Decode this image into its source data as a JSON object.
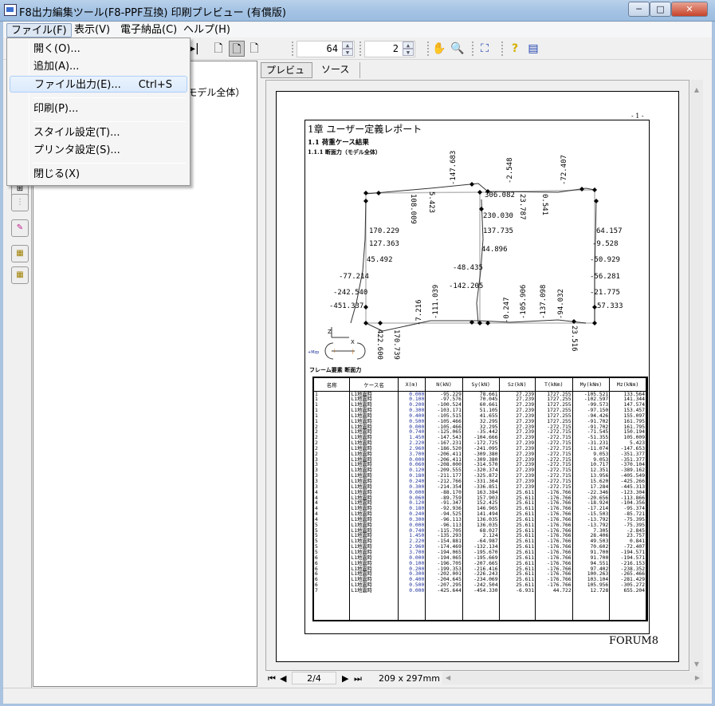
{
  "window": {
    "title": "F8出力編集ツール(F8-PPF互換) 印刷プレビュー (有償版)",
    "minimize": "─",
    "maximize": "□",
    "close": "✕"
  },
  "menubar": {
    "items": [
      "ファイル(F)",
      "表示(V)",
      "電子納品(C)",
      "ヘルプ(H)"
    ]
  },
  "file_menu": {
    "items": [
      {
        "label": "開く(O)..."
      },
      {
        "label": "追加(A)..."
      },
      {
        "label": "ファイル出力(E)...",
        "shortcut": "Ctrl+S"
      },
      {
        "label": "印刷(P)..."
      },
      {
        "label": "スタイル設定(T)..."
      },
      {
        "label": "プリンタ設定(S)..."
      },
      {
        "label": "閉じる(X)"
      }
    ]
  },
  "toolbar": {
    "zoom_value": "64",
    "page_value": "2"
  },
  "tree": {
    "item": "1-1-1 断面力（モデル全体）"
  },
  "tabs": [
    "プレビュー",
    "ソース"
  ],
  "report": {
    "page_number": "- 1 -",
    "chapter": "1章 ユーザー定義レポート",
    "section": "1.1 荷重ケース結果",
    "subsection": "1.1.1 断面力（モデル全体）",
    "table_caption": "フレーム要素 断面力",
    "footer": "FORUM8",
    "diagram": {
      "axis_z": "Z",
      "axis_x": "X",
      "legend_left": "+Mzp",
      "legend_i": "i",
      "legend_j": "j",
      "labels": [
        "170.229",
        "127.363",
        "45.492",
        "-77.214",
        "-242.540",
        "-451.337",
        "230.030",
        "137.735",
        "44.896",
        "-48.435",
        "-142.205",
        "64.157",
        "-9.528",
        "-50.929",
        "-56.281",
        "-21.775",
        "57.333",
        "306.082",
        "-147.683",
        "-2.548",
        "-72.407",
        "108.009",
        "5.423",
        "23.787",
        "0.541",
        "-7.216",
        "-111.039",
        "-0.247",
        "-105.906",
        "-137.098",
        "-94.032",
        "170.739",
        "23.516",
        "422.600"
      ]
    },
    "table": {
      "headers": [
        "名称",
        "ケース名",
        "X(m)",
        "N(kN)",
        "Sy(kN)",
        "Sz(kN)",
        "T(kNm)",
        "My(kNm)",
        "Mz(kNm)"
      ],
      "rows": [
        [
          "1",
          "L1地震時",
          "0.000",
          "-95.229",
          "78.661",
          "27.239",
          "1727.255",
          "-105.521",
          "133.564"
        ],
        [
          "1",
          "L1地震時",
          "0.100",
          "-97.576",
          "70.045",
          "27.239",
          "1727.255",
          "-102.597",
          "141.344"
        ],
        [
          "1",
          "L1地震時",
          "0.200",
          "-100.524",
          "60.661",
          "27.239",
          "1727.255",
          "-99.573",
          "147.574"
        ],
        [
          "1",
          "L1地震時",
          "0.300",
          "-103.171",
          "51.105",
          "27.239",
          "1727.255",
          "-97.150",
          "153.457"
        ],
        [
          "1",
          "L1地震時",
          "0.400",
          "-105.515",
          "41.655",
          "27.239",
          "1727.255",
          "-94.426",
          "155.097"
        ],
        [
          "1",
          "L1地震時",
          "0.500",
          "-105.466",
          "32.295",
          "27.239",
          "1727.255",
          "-91.702",
          "161.795"
        ],
        [
          "2",
          "L1地震時",
          "0.000",
          "-105.466",
          "32.295",
          "27.239",
          "-272.715",
          "-91.702",
          "161.795"
        ],
        [
          "2",
          "L1地震時",
          "0.740",
          "-125.065",
          "-35.442",
          "27.239",
          "-272.715",
          "-71.545",
          "150.194"
        ],
        [
          "2",
          "L1地震時",
          "1.450",
          "-147.543",
          "-104.666",
          "27.239",
          "-272.715",
          "-51.355",
          "105.009"
        ],
        [
          "2",
          "L1地震時",
          "2.220",
          "-167.231",
          "-172.725",
          "27.239",
          "-272.715",
          "-31.231",
          "5.423"
        ],
        [
          "2",
          "L1地震時",
          "2.960",
          "-186.520",
          "-241.095",
          "27.239",
          "-272.715",
          "-11.074",
          "-147.653"
        ],
        [
          "2",
          "L1地震時",
          "3.700",
          "-206.411",
          "-309.380",
          "27.239",
          "-272.715",
          "9.053",
          "-351.377"
        ],
        [
          "3",
          "L1地震時",
          "0.000",
          "-206.411",
          "-309.380",
          "27.239",
          "-272.715",
          "9.053",
          "-351.377"
        ],
        [
          "3",
          "L1地震時",
          "0.060",
          "-208.000",
          "-314.570",
          "27.239",
          "-272.715",
          "10.717",
          "-370.104"
        ],
        [
          "3",
          "L1地震時",
          "0.120",
          "-209.555",
          "-320.374",
          "27.239",
          "-272.715",
          "12.351",
          "-389.162"
        ],
        [
          "3",
          "L1地震時",
          "0.180",
          "-211.177",
          "-325.872",
          "27.239",
          "-272.715",
          "13.956",
          "-405.549"
        ],
        [
          "3",
          "L1地震時",
          "0.240",
          "-212.766",
          "-331.364",
          "27.239",
          "-272.715",
          "15.620",
          "-425.266"
        ],
        [
          "3",
          "L1地震時",
          "0.300",
          "-214.354",
          "-336.851",
          "27.239",
          "-272.715",
          "17.284",
          "-445.313"
        ],
        [
          "4",
          "L1地震時",
          "0.000",
          "-88.170",
          "163.384",
          "25.611",
          "-176.766",
          "-22.346",
          "-123.304"
        ],
        [
          "4",
          "L1地震時",
          "0.060",
          "-89.759",
          "157.903",
          "25.611",
          "-176.766",
          "-20.656",
          "-113.866"
        ],
        [
          "4",
          "L1地震時",
          "0.120",
          "-91.347",
          "152.425",
          "25.611",
          "-176.766",
          "-18.924",
          "-104.356"
        ],
        [
          "4",
          "L1地震時",
          "0.180",
          "-92.936",
          "146.965",
          "25.611",
          "-176.766",
          "-17.214",
          "-95.374"
        ],
        [
          "4",
          "L1地震時",
          "0.240",
          "-94.525",
          "141.494",
          "25.611",
          "-176.766",
          "-15.503",
          "-85.721"
        ],
        [
          "4",
          "L1地震時",
          "0.300",
          "-96.113",
          "136.035",
          "25.611",
          "-176.766",
          "-13.792",
          "-75.395"
        ],
        [
          "5",
          "L1地震時",
          "0.000",
          "-96.113",
          "136.035",
          "25.611",
          "-176.766",
          "-13.792",
          "-75.395"
        ],
        [
          "5",
          "L1地震時",
          "0.740",
          "-115.705",
          "68.027",
          "25.611",
          "-176.766",
          "7.305",
          "-2.845"
        ],
        [
          "5",
          "L1地震時",
          "1.450",
          "-135.293",
          "2.124",
          "25.611",
          "-176.766",
          "28.406",
          "23.757"
        ],
        [
          "5",
          "L1地震時",
          "2.220",
          "-154.881",
          "-64.987",
          "25.611",
          "-176.766",
          "49.503",
          "0.841"
        ],
        [
          "5",
          "L1地震時",
          "2.960",
          "-174.469",
          "-132.134",
          "25.611",
          "-176.766",
          "70.602",
          "-72.407"
        ],
        [
          "5",
          "L1地震時",
          "3.700",
          "-194.065",
          "-195.670",
          "25.611",
          "-176.766",
          "91.700",
          "-194.571"
        ],
        [
          "6",
          "L1地震時",
          "0.000",
          "-194.065",
          "-195.669",
          "25.611",
          "-176.766",
          "91.700",
          "-194.571"
        ],
        [
          "6",
          "L1地震時",
          "0.100",
          "-196.705",
          "-207.665",
          "25.611",
          "-176.766",
          "94.551",
          "-216.153"
        ],
        [
          "6",
          "L1地震時",
          "0.200",
          "-199.353",
          "-216.416",
          "25.611",
          "-176.766",
          "97.402",
          "-238.352"
        ],
        [
          "6",
          "L1地震時",
          "0.300",
          "-202.001",
          "-226.243",
          "25.611",
          "-176.766",
          "100.263",
          "-265.466"
        ],
        [
          "6",
          "L1地震時",
          "0.400",
          "-204.645",
          "-234.069",
          "25.611",
          "-176.766",
          "103.104",
          "-281.429"
        ],
        [
          "6",
          "L1地震時",
          "0.500",
          "-207.295",
          "-242.504",
          "25.611",
          "-176.766",
          "105.956",
          "-305.272"
        ],
        [
          "7",
          "L1地震時",
          "0.000",
          "-425.644",
          "-454.330",
          "-6.931",
          "44.722",
          "12.728",
          "655.204"
        ]
      ]
    }
  },
  "navbar": {
    "page": "2/4",
    "paper_size": "209 x 297mm"
  }
}
